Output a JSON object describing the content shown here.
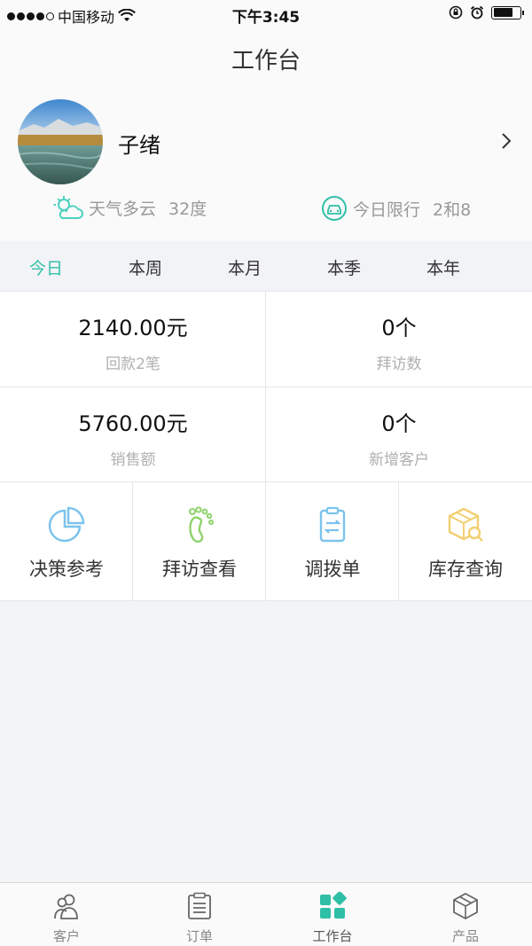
{
  "status_bar": {
    "carrier": "中国移动",
    "time": "下午3:45",
    "icons": [
      "signal-dots",
      "wifi-icon",
      "rotation-lock-icon",
      "alarm-icon",
      "battery-icon"
    ],
    "battery_level_percent": 75
  },
  "header": {
    "title": "工作台"
  },
  "profile": {
    "name": "子绪",
    "avatar": "landscape-photo",
    "weather": {
      "icon": "partly-cloudy-icon",
      "label": "天气多云",
      "value": "32度"
    },
    "traffic": {
      "icon": "car-icon",
      "label": "今日限行",
      "value": "2和8"
    }
  },
  "period_tabs": [
    {
      "label": "今日",
      "active": true
    },
    {
      "label": "本周",
      "active": false
    },
    {
      "label": "本月",
      "active": false
    },
    {
      "label": "本季",
      "active": false
    },
    {
      "label": "本年",
      "active": false
    }
  ],
  "stats": [
    {
      "value": "2140.00元",
      "label": "回款2笔"
    },
    {
      "value": "0个",
      "label": "拜访数"
    },
    {
      "value": "5760.00元",
      "label": "销售额"
    },
    {
      "value": "0个",
      "label": "新增客户"
    }
  ],
  "shortcuts": [
    {
      "label": "决策参考",
      "icon": "pie-chart-icon"
    },
    {
      "label": "拜访查看",
      "icon": "footprint-icon"
    },
    {
      "label": "调拨单",
      "icon": "clipboard-transfer-icon"
    },
    {
      "label": "库存查询",
      "icon": "box-search-icon"
    }
  ],
  "bottom_nav": [
    {
      "label": "客户",
      "icon": "customers-icon",
      "active": false
    },
    {
      "label": "订单",
      "icon": "orders-icon",
      "active": false
    },
    {
      "label": "工作台",
      "icon": "workbench-icon",
      "active": true
    },
    {
      "label": "产品",
      "icon": "product-cube-icon",
      "active": false
    }
  ],
  "colors": {
    "accent": "#2fbfa6",
    "weather_icon": "#4fd0c0",
    "shortcut_blue": "#7cc3ec",
    "shortcut_green": "#8fd36b",
    "shortcut_yellow": "#f3cf72",
    "background": "#f2f3f7"
  }
}
